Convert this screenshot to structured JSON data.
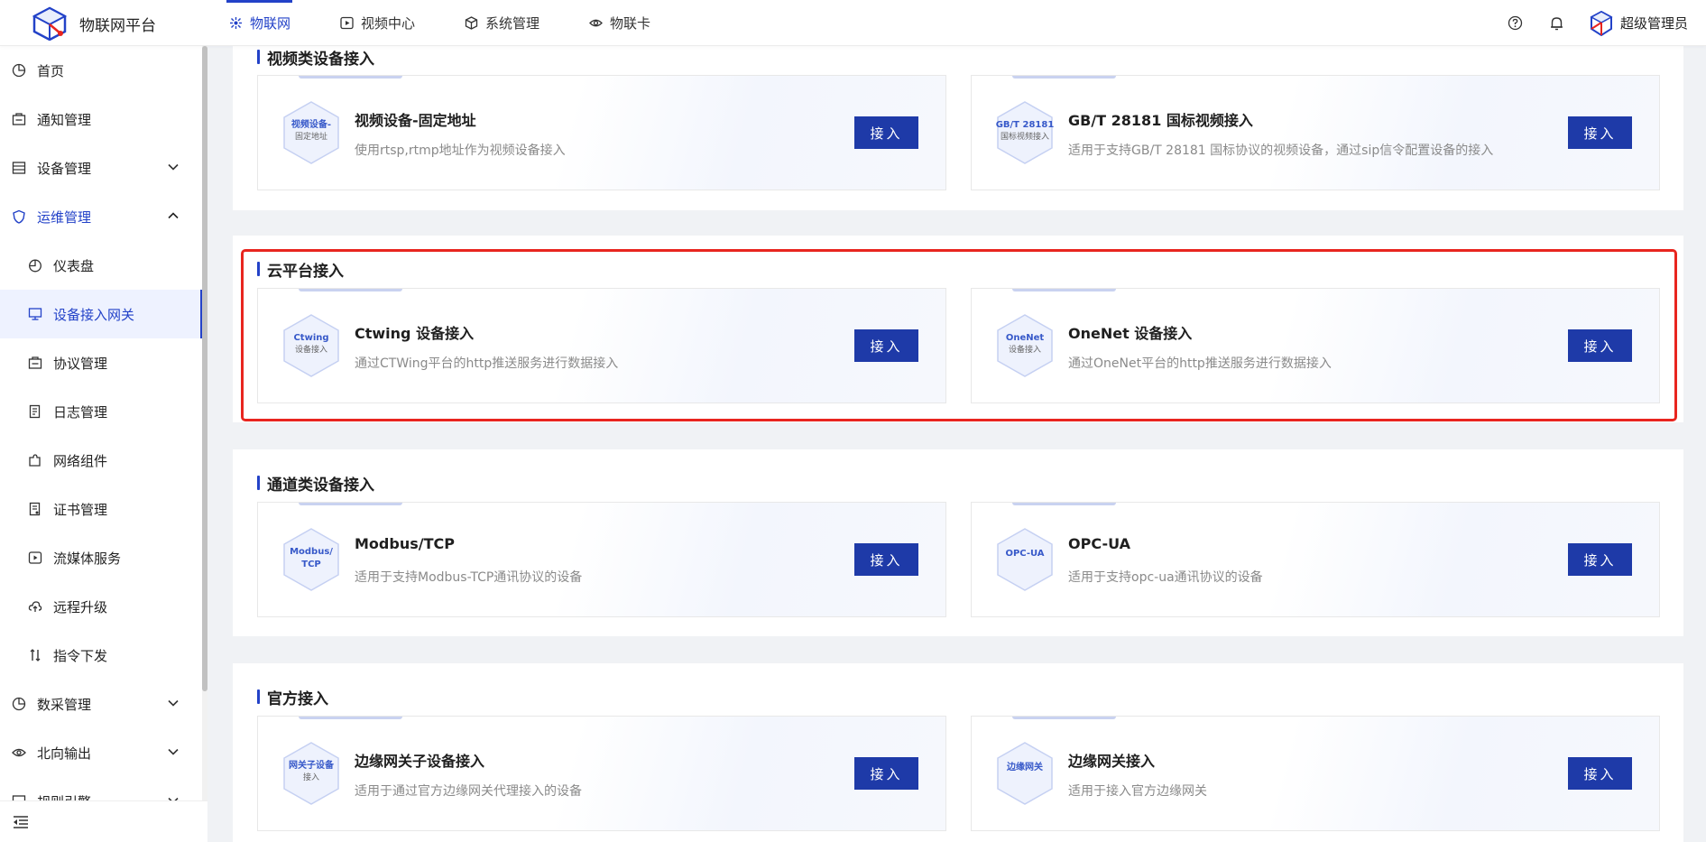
{
  "app": {
    "title": "物联网平台"
  },
  "nav": [
    {
      "label": "物联网",
      "icon": "iot-icon",
      "active": true
    },
    {
      "label": "视频中心",
      "icon": "video-icon",
      "active": false
    },
    {
      "label": "系统管理",
      "icon": "cube-icon",
      "active": false
    },
    {
      "label": "物联卡",
      "icon": "eye-icon",
      "active": false
    }
  ],
  "user": {
    "name": "超级管理员"
  },
  "sidebar": {
    "items": [
      {
        "label": "首页",
        "icon": "pie-icon",
        "level": 1,
        "arrow": ""
      },
      {
        "label": "通知管理",
        "icon": "bell-icon",
        "level": 1,
        "arrow": ""
      },
      {
        "label": "设备管理",
        "icon": "list-icon",
        "level": 1,
        "arrow": "down"
      },
      {
        "label": "运维管理",
        "icon": "shield-icon",
        "level": 1,
        "arrow": "up",
        "open": true
      },
      {
        "label": "仪表盘",
        "icon": "dashboard-icon",
        "level": 2,
        "arrow": ""
      },
      {
        "label": "设备接入网关",
        "icon": "monitor-icon",
        "level": 2,
        "arrow": "",
        "selected": true
      },
      {
        "label": "协议管理",
        "icon": "protocol-icon",
        "level": 2,
        "arrow": ""
      },
      {
        "label": "日志管理",
        "icon": "log-icon",
        "level": 2,
        "arrow": ""
      },
      {
        "label": "网络组件",
        "icon": "puzzle-icon",
        "level": 2,
        "arrow": ""
      },
      {
        "label": "证书管理",
        "icon": "certificate-icon",
        "level": 2,
        "arrow": ""
      },
      {
        "label": "流媒体服务",
        "icon": "play-icon",
        "level": 2,
        "arrow": ""
      },
      {
        "label": "远程升级",
        "icon": "cloud-upload-icon",
        "level": 2,
        "arrow": ""
      },
      {
        "label": "指令下发",
        "icon": "command-icon",
        "level": 2,
        "arrow": ""
      },
      {
        "label": "数采管理",
        "icon": "pie-icon",
        "level": 1,
        "arrow": "down"
      },
      {
        "label": "北向输出",
        "icon": "eye-icon",
        "level": 1,
        "arrow": "down"
      },
      {
        "label": "规则引擎",
        "icon": "rule-icon",
        "level": 1,
        "arrow": "down"
      }
    ]
  },
  "sections": [
    {
      "title": "视频类设备接入",
      "cards": [
        {
          "badge1": "视频设备-",
          "badge2": "固定地址",
          "title": "视频设备-固定地址",
          "desc": "使用rtsp,rtmp地址作为视频设备接入",
          "button": "接入"
        },
        {
          "badge1": "GB/T 28181",
          "badge2": "国标视频接入",
          "title": "GB/T 28181 国标视频接入",
          "desc": "适用于支持GB/T 28181 国标协议的视频设备，通过sip信令配置设备的接入",
          "button": "接入"
        }
      ]
    },
    {
      "title": "云平台接入",
      "cards": [
        {
          "badge1": "Ctwing",
          "badge2": "设备接入",
          "title": "Ctwing 设备接入",
          "desc": "通过CTWing平台的http推送服务进行数据接入",
          "button": "接入"
        },
        {
          "badge1": "OneNet",
          "badge2": "设备接入",
          "title": "OneNet 设备接入",
          "desc": "通过OneNet平台的http推送服务进行数据接入",
          "button": "接入"
        }
      ]
    },
    {
      "title": "通道类设备接入",
      "cards": [
        {
          "badge1": "Modbus/",
          "badge2": "TCP",
          "title": "Modbus/TCP",
          "desc": "适用于支持Modbus-TCP通讯协议的设备",
          "button": "接入"
        },
        {
          "badge1": "OPC-UA",
          "badge2": "",
          "title": "OPC-UA",
          "desc": "适用于支持opc-ua通讯协议的设备",
          "button": "接入"
        }
      ]
    },
    {
      "title": "官方接入",
      "cards": [
        {
          "badge1": "网关子设备",
          "badge2": "接入",
          "title": "边缘网关子设备接入",
          "desc": "适用于通过官方边缘网关代理接入的设备",
          "button": "接入"
        },
        {
          "badge1": "边缘网关",
          "badge2": "",
          "title": "边缘网关接入",
          "desc": "适用于接入官方边缘网关",
          "button": "接入"
        }
      ]
    }
  ]
}
